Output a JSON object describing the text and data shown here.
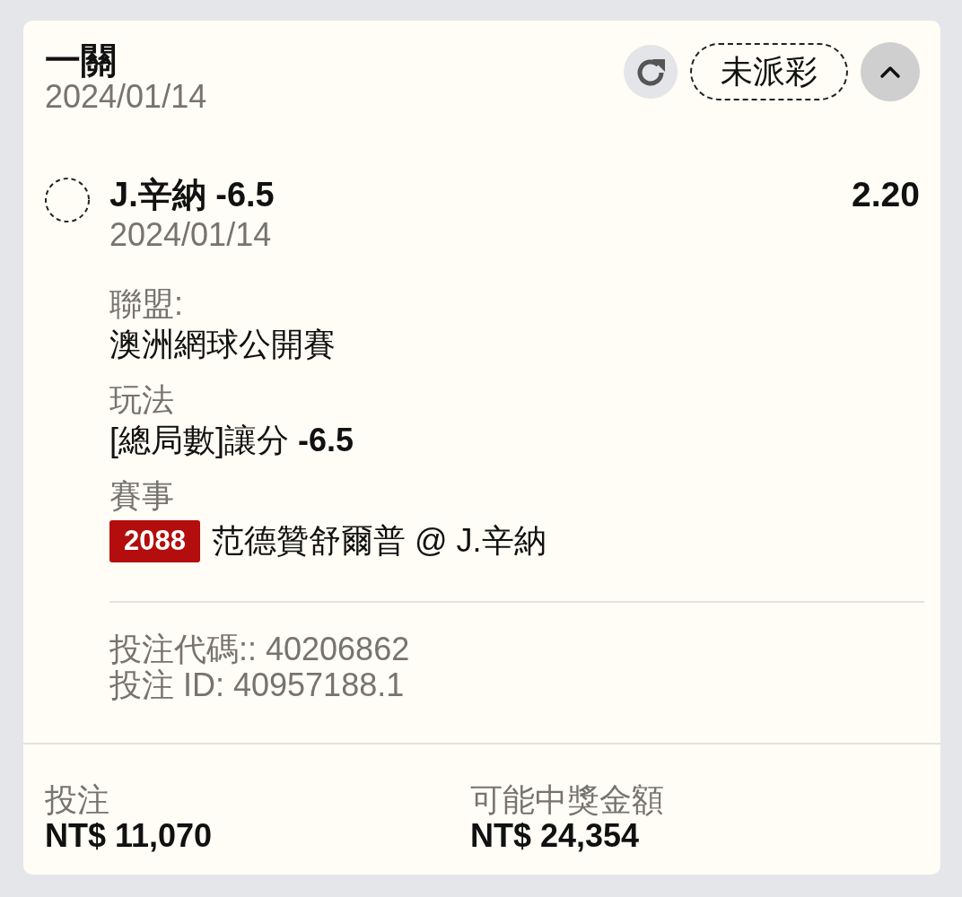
{
  "bet_card": {
    "title": "一關",
    "date": "2024/01/14",
    "status": "未派彩",
    "expanded": true
  },
  "selection": {
    "name": "J.辛納 -6.5",
    "odds": "2.20",
    "date": "2024/01/14"
  },
  "details": [
    {
      "label": "聯盟:",
      "value": "澳洲網球公開賽"
    },
    {
      "label": "玩法",
      "value": "[總局數]讓分 **-6.5**"
    },
    {
      "label": "賽事",
      "badge": "2088",
      "value": "范德贊舒爾普 @ J.辛納"
    }
  ],
  "codes": [
    "投注代碼:: 40206862",
    "投注 ID: 40957188.1"
  ],
  "summary": [
    {
      "label": "投注",
      "amount": "NT$ 11,070"
    },
    {
      "label": "可能中獎金額",
      "amount": "NT$ 24,354"
    }
  ]
}
